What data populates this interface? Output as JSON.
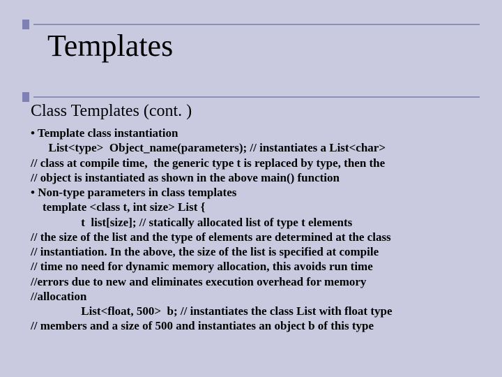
{
  "title": "Templates",
  "subtitle": "Class Templates (cont. )",
  "lines": [
    "• Template class instantiation",
    "      List<type>  Object_name(parameters); // instantiates a List<char>",
    "// class at compile time,  the generic type t is replaced by type, then the",
    "// object is instantiated as shown in the above main() function",
    "• Non-type parameters in class templates",
    "    template <class t, int size> List {",
    "                 t  list[size]; // statically allocated list of type t elements",
    "// the size of the list and the type of elements are determined at the class",
    "// instantiation. In the above, the size of the list is specified at compile",
    "// time no need for dynamic memory allocation, this avoids run time",
    "//errors due to new and eliminates execution overhead for memory",
    "//allocation",
    "                 List<float, 500>  b; // instantiates the class List with float type",
    "// members and a size of 500 and instantiates an object b of this type"
  ]
}
